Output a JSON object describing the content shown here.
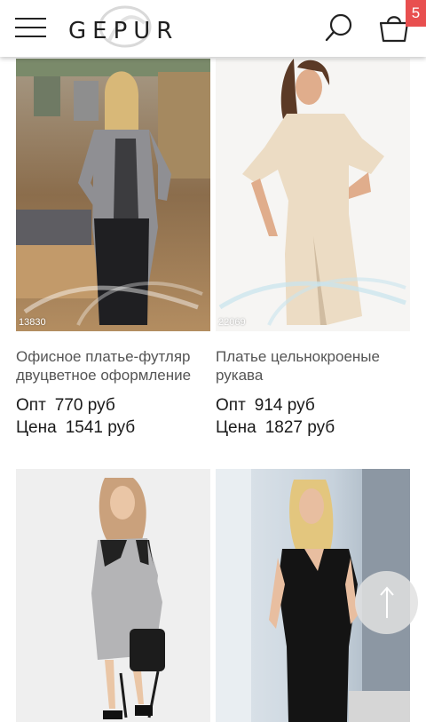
{
  "header": {
    "brand": "GEPUR",
    "cart_count": "5",
    "icons": {
      "menu": "hamburger-menu-icon",
      "search": "search-icon",
      "cart": "shopping-bag-icon"
    }
  },
  "products": [
    {
      "sku": "13830",
      "title": "Офисное платье-футляр двуцветное оформление",
      "opt_label": "Опт",
      "opt_price": "770 руб",
      "retail_label": "Цена",
      "retail_price": "1541 руб"
    },
    {
      "sku": "22069",
      "title": "Платье цельнокроеные рукава",
      "opt_label": "Опт",
      "opt_price": "914 руб",
      "retail_label": "Цена",
      "retail_price": "1827 руб"
    },
    {
      "sku": "",
      "title": ""
    },
    {
      "sku": "",
      "title": ""
    }
  ],
  "scroll_top": {
    "icon": "arrow-up-icon"
  },
  "colors": {
    "badge": "#e84f4f",
    "text": "#333333",
    "title": "#555555"
  }
}
